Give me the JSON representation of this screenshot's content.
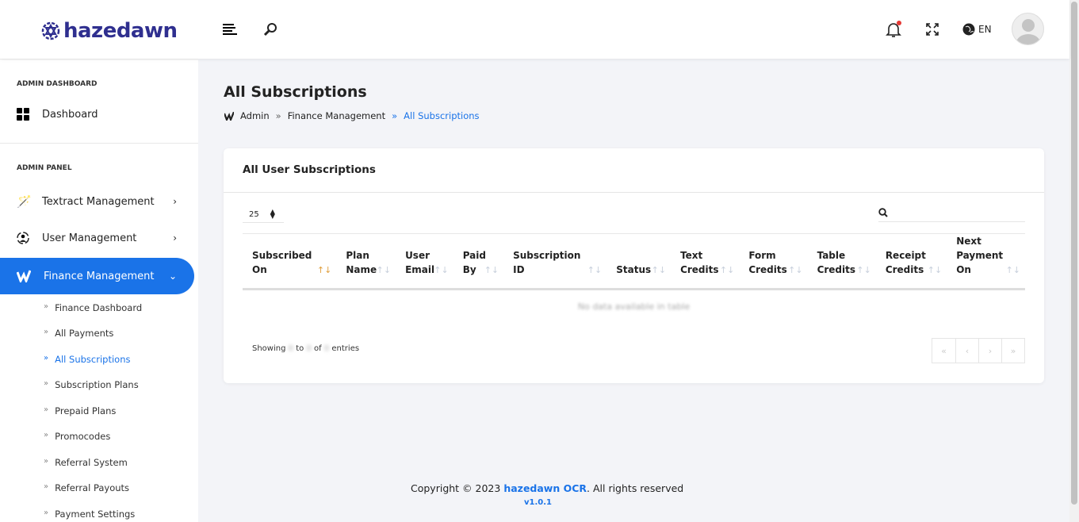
{
  "brand": {
    "name": "hazedawn",
    "color": "#2f2f8f"
  },
  "topbar": {
    "lang": "EN",
    "icons": [
      "menu-icon",
      "search-icon",
      "bell-icon",
      "fullscreen-icon",
      "globe-icon",
      "avatar"
    ]
  },
  "sidebar": {
    "sections": [
      {
        "title": "ADMIN DASHBOARD"
      },
      {
        "title": "ADMIN PANEL"
      }
    ],
    "dashboard": "Dashboard",
    "items": [
      {
        "label": "Textract Management"
      },
      {
        "label": "User Management"
      },
      {
        "label": "Finance Management"
      }
    ],
    "sub_items": [
      "Finance Dashboard",
      "All Payments",
      "All Subscriptions",
      "Subscription Plans",
      "Prepaid Plans",
      "Promocodes",
      "Referral System",
      "Referral Payouts",
      "Payment Settings"
    ]
  },
  "page": {
    "title": "All Subscriptions",
    "breadcrumb": [
      "Admin",
      "Finance Management",
      "All Subscriptions"
    ]
  },
  "card": {
    "title": "All User Subscriptions",
    "page_length": "25",
    "columns": [
      [
        "Subscribed",
        "On"
      ],
      [
        "Plan",
        "Name"
      ],
      [
        "User",
        "Email"
      ],
      [
        "Paid",
        "By"
      ],
      [
        "Subscription",
        "ID"
      ],
      [
        "",
        "Status"
      ],
      [
        "Text",
        "Credits"
      ],
      [
        "Form",
        "Credits"
      ],
      [
        "Table",
        "Credits"
      ],
      [
        "Receipt",
        "Credits"
      ],
      [
        "Next",
        "Payment",
        "On"
      ]
    ],
    "empty": "No data available in table",
    "info": {
      "a": "Showing",
      "from": "0",
      "b": "to",
      "to": "0",
      "c": "of",
      "total": "0",
      "d": "entries"
    },
    "pagination": [
      "«",
      "‹",
      "›",
      "»"
    ]
  },
  "footer": {
    "prefix": "Copyright © 2023",
    "brand": "hazedawn OCR",
    "suffix": ". All rights reserved",
    "version": "v1.0.1"
  },
  "colors": {
    "accent": "#1a73e8",
    "notification": "#e53935"
  }
}
